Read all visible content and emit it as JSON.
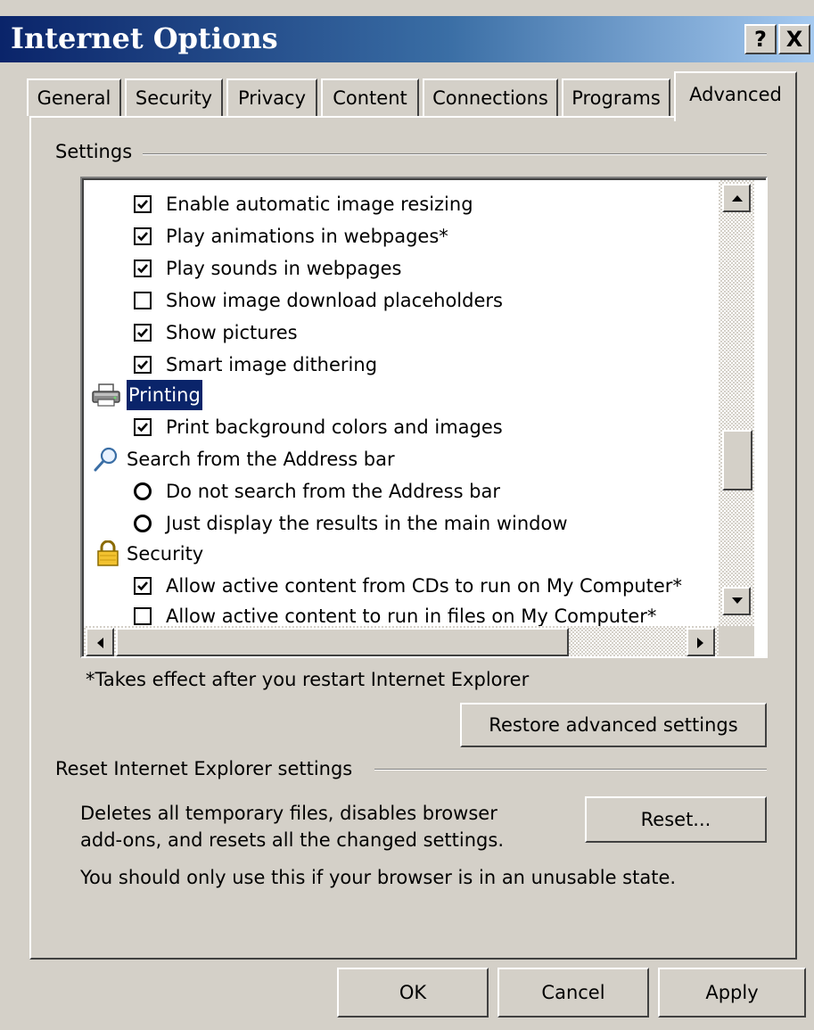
{
  "window": {
    "title": "Internet Options",
    "help_label": "?",
    "close_label": "X"
  },
  "tabs": [
    {
      "label": "General"
    },
    {
      "label": "Security"
    },
    {
      "label": "Privacy"
    },
    {
      "label": "Content"
    },
    {
      "label": "Connections"
    },
    {
      "label": "Programs"
    },
    {
      "label": "Advanced"
    }
  ],
  "active_tab": "Advanced",
  "settings": {
    "group_label": "Settings",
    "items": [
      {
        "type": "checkbox",
        "label": "Enable automatic image resizing",
        "checked": true
      },
      {
        "type": "checkbox",
        "label": "Play animations in webpages*",
        "checked": true
      },
      {
        "type": "checkbox",
        "label": "Play sounds in webpages",
        "checked": true
      },
      {
        "type": "checkbox",
        "label": "Show image download placeholders",
        "checked": false
      },
      {
        "type": "checkbox",
        "label": "Show pictures",
        "checked": true
      },
      {
        "type": "checkbox",
        "label": "Smart image dithering",
        "checked": true
      },
      {
        "type": "category",
        "label": "Printing",
        "icon": "printer-icon",
        "selected": true
      },
      {
        "type": "checkbox",
        "label": "Print background colors and images",
        "checked": true
      },
      {
        "type": "category",
        "label": "Search from the Address bar",
        "icon": "magnifier-icon"
      },
      {
        "type": "radio",
        "label": "Do not search from the Address bar",
        "selected": false
      },
      {
        "type": "radio",
        "label": "Just display the results in the main window",
        "selected": false
      },
      {
        "type": "category",
        "label": "Security",
        "icon": "padlock-icon"
      },
      {
        "type": "checkbox",
        "label": "Allow active content from CDs to run on My Computer*",
        "checked": true
      },
      {
        "type": "checkbox",
        "label": "Allow active content to run in files on My Computer*",
        "checked": false
      }
    ],
    "restart_note": "*Takes effect after you restart Internet Explorer",
    "restore_button": "Restore advanced settings"
  },
  "reset": {
    "group_label": "Reset Internet Explorer settings",
    "description_line1": "Deletes all temporary files, disables browser",
    "description_line2": "add-ons, and resets all the changed settings.",
    "button": "Reset...",
    "warning": "You should only use this if your browser is in an unusable state."
  },
  "footer": {
    "ok": "OK",
    "cancel": "Cancel",
    "apply": "Apply"
  },
  "colors": {
    "title_bar": "#0a246a",
    "selection": "#0a246a",
    "face": "#d4d0c8"
  }
}
